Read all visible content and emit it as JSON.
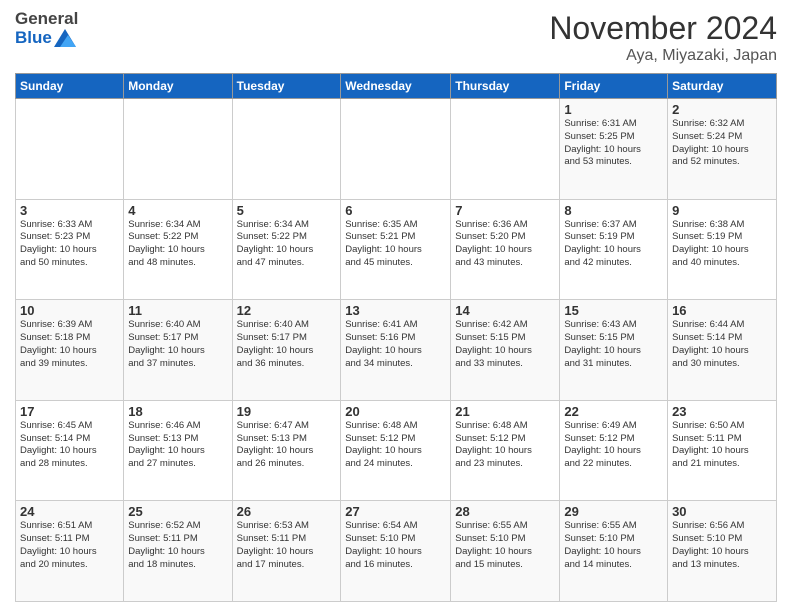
{
  "header": {
    "logo_general": "General",
    "logo_blue": "Blue",
    "title": "November 2024",
    "subtitle": "Aya, Miyazaki, Japan"
  },
  "days_of_week": [
    "Sunday",
    "Monday",
    "Tuesday",
    "Wednesday",
    "Thursday",
    "Friday",
    "Saturday"
  ],
  "weeks": [
    [
      {
        "num": "",
        "info": ""
      },
      {
        "num": "",
        "info": ""
      },
      {
        "num": "",
        "info": ""
      },
      {
        "num": "",
        "info": ""
      },
      {
        "num": "",
        "info": ""
      },
      {
        "num": "1",
        "info": "Sunrise: 6:31 AM\nSunset: 5:25 PM\nDaylight: 10 hours\nand 53 minutes."
      },
      {
        "num": "2",
        "info": "Sunrise: 6:32 AM\nSunset: 5:24 PM\nDaylight: 10 hours\nand 52 minutes."
      }
    ],
    [
      {
        "num": "3",
        "info": "Sunrise: 6:33 AM\nSunset: 5:23 PM\nDaylight: 10 hours\nand 50 minutes."
      },
      {
        "num": "4",
        "info": "Sunrise: 6:34 AM\nSunset: 5:22 PM\nDaylight: 10 hours\nand 48 minutes."
      },
      {
        "num": "5",
        "info": "Sunrise: 6:34 AM\nSunset: 5:22 PM\nDaylight: 10 hours\nand 47 minutes."
      },
      {
        "num": "6",
        "info": "Sunrise: 6:35 AM\nSunset: 5:21 PM\nDaylight: 10 hours\nand 45 minutes."
      },
      {
        "num": "7",
        "info": "Sunrise: 6:36 AM\nSunset: 5:20 PM\nDaylight: 10 hours\nand 43 minutes."
      },
      {
        "num": "8",
        "info": "Sunrise: 6:37 AM\nSunset: 5:19 PM\nDaylight: 10 hours\nand 42 minutes."
      },
      {
        "num": "9",
        "info": "Sunrise: 6:38 AM\nSunset: 5:19 PM\nDaylight: 10 hours\nand 40 minutes."
      }
    ],
    [
      {
        "num": "10",
        "info": "Sunrise: 6:39 AM\nSunset: 5:18 PM\nDaylight: 10 hours\nand 39 minutes."
      },
      {
        "num": "11",
        "info": "Sunrise: 6:40 AM\nSunset: 5:17 PM\nDaylight: 10 hours\nand 37 minutes."
      },
      {
        "num": "12",
        "info": "Sunrise: 6:40 AM\nSunset: 5:17 PM\nDaylight: 10 hours\nand 36 minutes."
      },
      {
        "num": "13",
        "info": "Sunrise: 6:41 AM\nSunset: 5:16 PM\nDaylight: 10 hours\nand 34 minutes."
      },
      {
        "num": "14",
        "info": "Sunrise: 6:42 AM\nSunset: 5:15 PM\nDaylight: 10 hours\nand 33 minutes."
      },
      {
        "num": "15",
        "info": "Sunrise: 6:43 AM\nSunset: 5:15 PM\nDaylight: 10 hours\nand 31 minutes."
      },
      {
        "num": "16",
        "info": "Sunrise: 6:44 AM\nSunset: 5:14 PM\nDaylight: 10 hours\nand 30 minutes."
      }
    ],
    [
      {
        "num": "17",
        "info": "Sunrise: 6:45 AM\nSunset: 5:14 PM\nDaylight: 10 hours\nand 28 minutes."
      },
      {
        "num": "18",
        "info": "Sunrise: 6:46 AM\nSunset: 5:13 PM\nDaylight: 10 hours\nand 27 minutes."
      },
      {
        "num": "19",
        "info": "Sunrise: 6:47 AM\nSunset: 5:13 PM\nDaylight: 10 hours\nand 26 minutes."
      },
      {
        "num": "20",
        "info": "Sunrise: 6:48 AM\nSunset: 5:12 PM\nDaylight: 10 hours\nand 24 minutes."
      },
      {
        "num": "21",
        "info": "Sunrise: 6:48 AM\nSunset: 5:12 PM\nDaylight: 10 hours\nand 23 minutes."
      },
      {
        "num": "22",
        "info": "Sunrise: 6:49 AM\nSunset: 5:12 PM\nDaylight: 10 hours\nand 22 minutes."
      },
      {
        "num": "23",
        "info": "Sunrise: 6:50 AM\nSunset: 5:11 PM\nDaylight: 10 hours\nand 21 minutes."
      }
    ],
    [
      {
        "num": "24",
        "info": "Sunrise: 6:51 AM\nSunset: 5:11 PM\nDaylight: 10 hours\nand 20 minutes."
      },
      {
        "num": "25",
        "info": "Sunrise: 6:52 AM\nSunset: 5:11 PM\nDaylight: 10 hours\nand 18 minutes."
      },
      {
        "num": "26",
        "info": "Sunrise: 6:53 AM\nSunset: 5:11 PM\nDaylight: 10 hours\nand 17 minutes."
      },
      {
        "num": "27",
        "info": "Sunrise: 6:54 AM\nSunset: 5:10 PM\nDaylight: 10 hours\nand 16 minutes."
      },
      {
        "num": "28",
        "info": "Sunrise: 6:55 AM\nSunset: 5:10 PM\nDaylight: 10 hours\nand 15 minutes."
      },
      {
        "num": "29",
        "info": "Sunrise: 6:55 AM\nSunset: 5:10 PM\nDaylight: 10 hours\nand 14 minutes."
      },
      {
        "num": "30",
        "info": "Sunrise: 6:56 AM\nSunset: 5:10 PM\nDaylight: 10 hours\nand 13 minutes."
      }
    ]
  ]
}
